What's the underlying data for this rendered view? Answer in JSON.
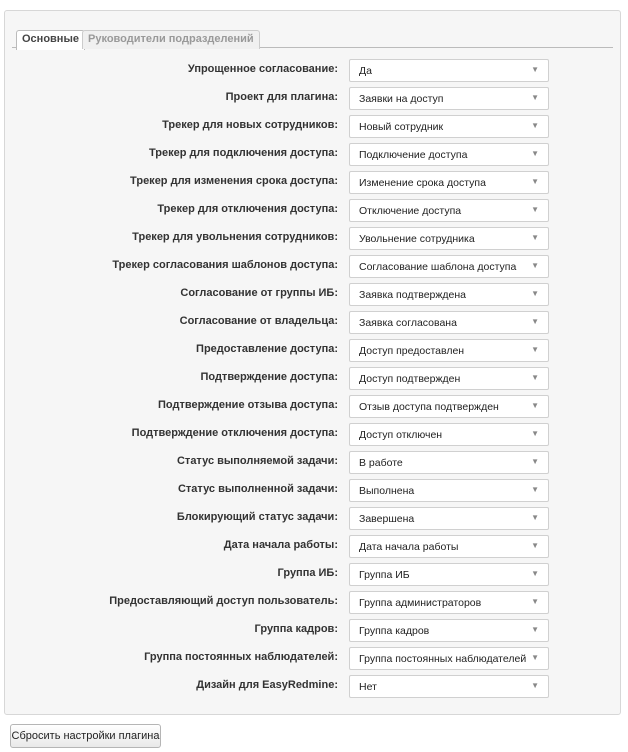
{
  "tabs": [
    {
      "label": "Основные",
      "active": true
    },
    {
      "label": "Руководители подразделений",
      "active": false
    }
  ],
  "settings": [
    {
      "label": "Упрощенное согласование:",
      "value": "Да"
    },
    {
      "label": "Проект для плагина:",
      "value": "Заявки на доступ"
    },
    {
      "label": "Трекер для новых сотрудников:",
      "value": "Новый сотрудник"
    },
    {
      "label": "Трекер для подключения доступа:",
      "value": "Подключение доступа"
    },
    {
      "label": "Трекер для изменения срока доступа:",
      "value": "Изменение срока доступа"
    },
    {
      "label": "Трекер для отключения доступа:",
      "value": "Отключение доступа"
    },
    {
      "label": "Трекер для увольнения сотрудников:",
      "value": "Увольнение сотрудника"
    },
    {
      "label": "Трекер согласования шаблонов доступа:",
      "value": "Согласование шаблона доступа"
    },
    {
      "label": "Согласование от группы ИБ:",
      "value": "Заявка подтверждена"
    },
    {
      "label": "Согласование от владельца:",
      "value": "Заявка согласована"
    },
    {
      "label": "Предоставление доступа:",
      "value": "Доступ предоставлен"
    },
    {
      "label": "Подтверждение доступа:",
      "value": "Доступ подтвержден"
    },
    {
      "label": "Подтверждение отзыва доступа:",
      "value": "Отзыв доступа подтвержден"
    },
    {
      "label": "Подтверждение отключения доступа:",
      "value": "Доступ отключен"
    },
    {
      "label": "Статус выполняемой задачи:",
      "value": "В работе"
    },
    {
      "label": "Статус выполненной задачи:",
      "value": "Выполнена"
    },
    {
      "label": "Блокирующий статус задачи:",
      "value": "Завершена"
    },
    {
      "label": "Дата начала работы:",
      "value": "Дата начала работы"
    },
    {
      "label": "Группа ИБ:",
      "value": "Группа ИБ"
    },
    {
      "label": "Предоставляющий доступ пользователь:",
      "value": "Группа администраторов"
    },
    {
      "label": "Группа кадров:",
      "value": "Группа кадров"
    },
    {
      "label": "Группа постоянных наблюдателей:",
      "value": "Группа постоянных наблюдателей"
    },
    {
      "label": "Дизайн для EasyRedmine:",
      "value": "Нет"
    }
  ],
  "reset_button": "Сбросить настройки плагина",
  "dropdown_arrow": "▼",
  "icons": {
    "dropdown": "chevron-down-icon"
  }
}
